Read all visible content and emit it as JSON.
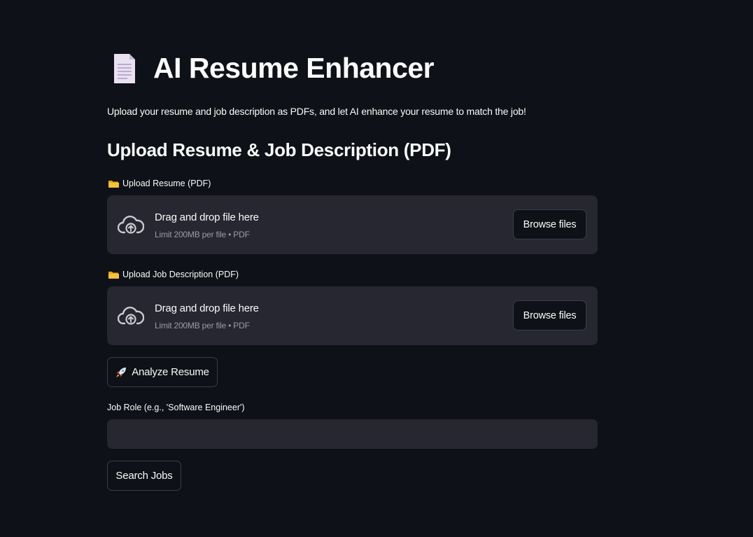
{
  "header": {
    "icon": "document-icon",
    "title": "AI Resume Enhancer",
    "subtitle": "Upload your resume and job description as PDFs, and let AI enhance your resume to match the job!"
  },
  "upload_section": {
    "heading": "Upload Resume & Job Description (PDF)",
    "resume": {
      "label_icon": "folder-icon",
      "label": "Upload Resume (PDF)",
      "dropzone_text": "Drag and drop file here",
      "dropzone_limit": "Limit 200MB per file • PDF",
      "browse_label": "Browse files"
    },
    "job_description": {
      "label_icon": "folder-icon",
      "label": "Upload Job Description (PDF)",
      "dropzone_text": "Drag and drop file here",
      "dropzone_limit": "Limit 200MB per file • PDF",
      "browse_label": "Browse files"
    }
  },
  "analyze_button": {
    "icon": "rocket-icon",
    "label": "Analyze Resume"
  },
  "job_search": {
    "input_label": "Job Role (e.g., 'Software Engineer')",
    "input_value": "",
    "button_label": "Search Jobs"
  },
  "colors": {
    "background": "#0e1117",
    "surface": "#262730",
    "text": "#fafafa",
    "muted_text": "#9a9ca5",
    "border": "#3b3e47"
  }
}
